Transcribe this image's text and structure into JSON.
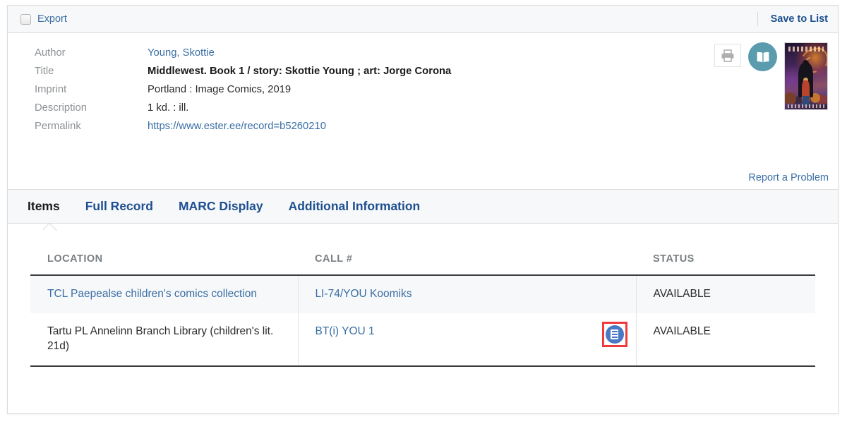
{
  "toolbar": {
    "export_label": "Export",
    "save_to_list_label": "Save to List"
  },
  "record": {
    "fields": [
      {
        "label": "Author",
        "value": "Young, Skottie",
        "style": "link"
      },
      {
        "label": "Title",
        "value": "Middlewest. Book 1 / story: Skottie Young ; art: Jorge Corona",
        "style": "bold"
      },
      {
        "label": "Imprint",
        "value": "Portland : Image Comics, 2019",
        "style": "plain"
      },
      {
        "label": "Description",
        "value": "1 kd. : ill.",
        "style": "plain"
      },
      {
        "label": "Permalink",
        "value": "https://www.ester.ee/record=b5260210",
        "style": "link"
      }
    ],
    "report_problem_label": "Report a Problem",
    "print_icon": "printer-icon",
    "preview_icon": "open-book-icon",
    "cover_alt": "Middlewest Book 1 cover"
  },
  "tabs": [
    {
      "label": "Items",
      "active": true
    },
    {
      "label": "Full Record",
      "active": false
    },
    {
      "label": "MARC Display",
      "active": false
    },
    {
      "label": "Additional Information",
      "active": false
    }
  ],
  "items": {
    "columns": [
      "LOCATION",
      "CALL #",
      "STATUS"
    ],
    "rows": [
      {
        "location": "TCL Paepealse children's comics collection",
        "location_link": true,
        "call": "LI-74/YOU Koomiks",
        "call_link": true,
        "status": "AVAILABLE",
        "shelf_icon": false
      },
      {
        "location": "Tartu PL Annelinn Branch Library (children's lit. 21d)",
        "location_link": false,
        "call": "BT(i) YOU 1",
        "call_link": true,
        "status": "AVAILABLE",
        "shelf_icon": true,
        "shelf_icon_name": "shelf-browse-icon",
        "shelf_icon_highlighted": true
      }
    ]
  },
  "colors": {
    "link": "#3a6ea5",
    "link_strong": "#1d4f91",
    "label_gray": "#8d9194",
    "toolbar_bg": "#f7f8f9",
    "border": "#dcdcdc",
    "book_icon_teal": "#5b9bae",
    "shelf_icon_blue": "#4a79c4",
    "highlight_red": "#ef3b3b"
  }
}
